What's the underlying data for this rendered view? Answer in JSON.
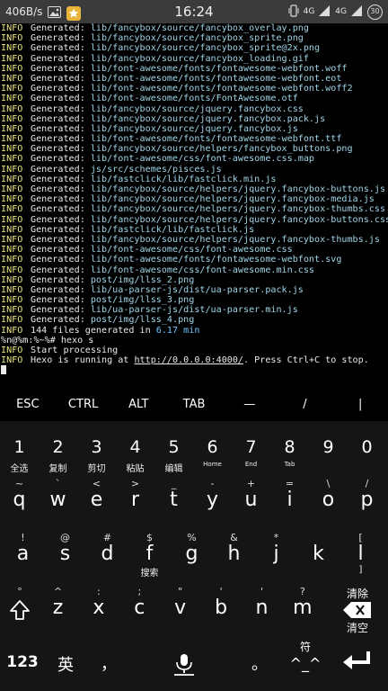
{
  "status_bar": {
    "speed": "406B/s",
    "time": "16:24",
    "network": "4G",
    "battery": "30"
  },
  "terminal": {
    "lines": [
      {
        "level": "INFO",
        "text": "Generated: ",
        "path": "lib/fancybox/source/fancybox_overlay.png"
      },
      {
        "level": "INFO",
        "text": "Generated: ",
        "path": "lib/fancybox/source/fancybox_sprite.png"
      },
      {
        "level": "INFO",
        "text": "Generated: ",
        "path": "lib/fancybox/source/fancybox_sprite@2x.png"
      },
      {
        "level": "INFO",
        "text": "Generated: ",
        "path": "lib/fancybox/source/fancybox_loading.gif"
      },
      {
        "level": "INFO",
        "text": "Generated: ",
        "path": "lib/font-awesome/fonts/fontawesome-webfont.woff"
      },
      {
        "level": "INFO",
        "text": "Generated: ",
        "path": "lib/font-awesome/fonts/fontawesome-webfont.eot"
      },
      {
        "level": "INFO",
        "text": "Generated: ",
        "path": "lib/font-awesome/fonts/fontawesome-webfont.woff2"
      },
      {
        "level": "INFO",
        "text": "Generated: ",
        "path": "lib/font-awesome/fonts/FontAwesome.otf"
      },
      {
        "level": "INFO",
        "text": "Generated: ",
        "path": "lib/fancybox/source/jquery.fancybox.css"
      },
      {
        "level": "INFO",
        "text": "Generated: ",
        "path": "lib/fancybox/source/jquery.fancybox.pack.js"
      },
      {
        "level": "INFO",
        "text": "Generated: ",
        "path": "lib/fancybox/source/jquery.fancybox.js"
      },
      {
        "level": "INFO",
        "text": "Generated: ",
        "path": "lib/font-awesome/fonts/fontawesome-webfont.ttf"
      },
      {
        "level": "INFO",
        "text": "Generated: ",
        "path": "lib/fancybox/source/helpers/fancybox_buttons.png"
      },
      {
        "level": "INFO",
        "text": "Generated: ",
        "path": "lib/font-awesome/css/font-awesome.css.map"
      },
      {
        "level": "INFO",
        "text": "Generated: ",
        "path": "js/src/schemes/pisces.js"
      },
      {
        "level": "INFO",
        "text": "Generated: ",
        "path": "lib/fastclick/lib/fastclick.min.js"
      },
      {
        "level": "INFO",
        "text": "Generated: ",
        "path": "lib/fancybox/source/helpers/jquery.fancybox-buttons.js"
      },
      {
        "level": "INFO",
        "text": "Generated: ",
        "path": "lib/fancybox/source/helpers/jquery.fancybox-media.js"
      },
      {
        "level": "INFO",
        "text": "Generated: ",
        "path": "lib/fancybox/source/helpers/jquery.fancybox-thumbs.css"
      },
      {
        "level": "INFO",
        "text": "Generated: ",
        "path": "lib/fancybox/source/helpers/jquery.fancybox-buttons.css"
      },
      {
        "level": "INFO",
        "text": "Generated: ",
        "path": "lib/fastclick/lib/fastclick.js"
      },
      {
        "level": "INFO",
        "text": "Generated: ",
        "path": "lib/fancybox/source/helpers/jquery.fancybox-thumbs.js"
      },
      {
        "level": "INFO",
        "text": "Generated: ",
        "path": "lib/font-awesome/css/font-awesome.css"
      },
      {
        "level": "INFO",
        "text": "Generated: ",
        "path": "lib/font-awesome/fonts/fontawesome-webfont.svg"
      },
      {
        "level": "INFO",
        "text": "Generated: ",
        "path": "lib/font-awesome/css/font-awesome.min.css"
      },
      {
        "level": "INFO",
        "text": "Generated: ",
        "path": "post/img/llss_2.png"
      },
      {
        "level": "INFO",
        "text": "Generated: ",
        "path": "lib/ua-parser-js/dist/ua-parser.pack.js"
      },
      {
        "level": "INFO",
        "text": "Generated: ",
        "path": "post/img/llss_3.png"
      },
      {
        "level": "INFO",
        "text": "Generated: ",
        "path": "lib/ua-parser-js/dist/ua-parser.min.js"
      },
      {
        "level": "INFO",
        "text": "Generated: ",
        "path": "post/img/llss_4.png"
      }
    ],
    "summary": {
      "level": "INFO",
      "pre": "144 files generated in ",
      "num": "6.17 min"
    },
    "prompt": "%n@%m:%~%# hexo s",
    "start": {
      "level": "INFO",
      "text": "Start processing"
    },
    "running": {
      "level": "INFO",
      "pre": "Hexo is running at ",
      "url": "http://0.0.0.0:4000/",
      "post": ". Press Ctrl+C to stop."
    }
  },
  "extra_keys": [
    "ESC",
    "CTRL",
    "ALT",
    "TAB",
    "—",
    "/",
    "|"
  ],
  "keyboard": {
    "number_row": [
      {
        "main": "1",
        "sub": "全选"
      },
      {
        "main": "2",
        "sub": "复制"
      },
      {
        "main": "3",
        "sub": "剪切"
      },
      {
        "main": "4",
        "sub": "粘贴"
      },
      {
        "main": "5",
        "sub": "编辑"
      },
      {
        "main": "6",
        "sub": "Home"
      },
      {
        "main": "7",
        "sub": "End"
      },
      {
        "main": "8",
        "sub": "Tab"
      },
      {
        "main": "9",
        "sub": ""
      },
      {
        "main": "0",
        "sub": ""
      }
    ],
    "row1": [
      {
        "sup": "~",
        "main": "q"
      },
      {
        "sup": "`",
        "main": "w"
      },
      {
        "sup": "<",
        "main": "e"
      },
      {
        "sup": ">",
        "main": "r"
      },
      {
        "sup": "_",
        "main": "t"
      },
      {
        "sup": "-",
        "main": "y"
      },
      {
        "sup": "+",
        "main": "u"
      },
      {
        "sup": "=",
        "main": "i"
      },
      {
        "sup": "\\",
        "main": "o"
      },
      {
        "sup": "/",
        "main": "p"
      }
    ],
    "row2": [
      {
        "sup": "!",
        "main": "a"
      },
      {
        "sup": "@",
        "main": "s"
      },
      {
        "sup": "#",
        "main": "d"
      },
      {
        "sup": "$",
        "main": "f",
        "sub": "搜索"
      },
      {
        "sup": "%",
        "main": "g"
      },
      {
        "sup": "&",
        "main": "h"
      },
      {
        "sup": "*",
        "main": "j"
      },
      {
        "sup": "",
        "main": "k"
      },
      {
        "sup": "[",
        "main": "l",
        "sub": "]"
      }
    ],
    "row3": [
      {
        "sup": "^",
        "main": "z"
      },
      {
        "sup": ":",
        "main": "x"
      },
      {
        "sup": ";",
        "main": "c"
      },
      {
        "sup": "\"",
        "main": "v"
      },
      {
        "sup": "'",
        "main": "b"
      },
      {
        "sup": "'",
        "main": "n"
      },
      {
        "sup": "?",
        "main": "m"
      }
    ],
    "shift_sup": "°",
    "delete_top": "清除",
    "delete_bottom": "清空",
    "bottom": {
      "num_key": "123",
      "lang_key": "英",
      "comma": "，",
      "period": "。",
      "symbol_top": "符",
      "symbol_face": "^_^"
    }
  }
}
